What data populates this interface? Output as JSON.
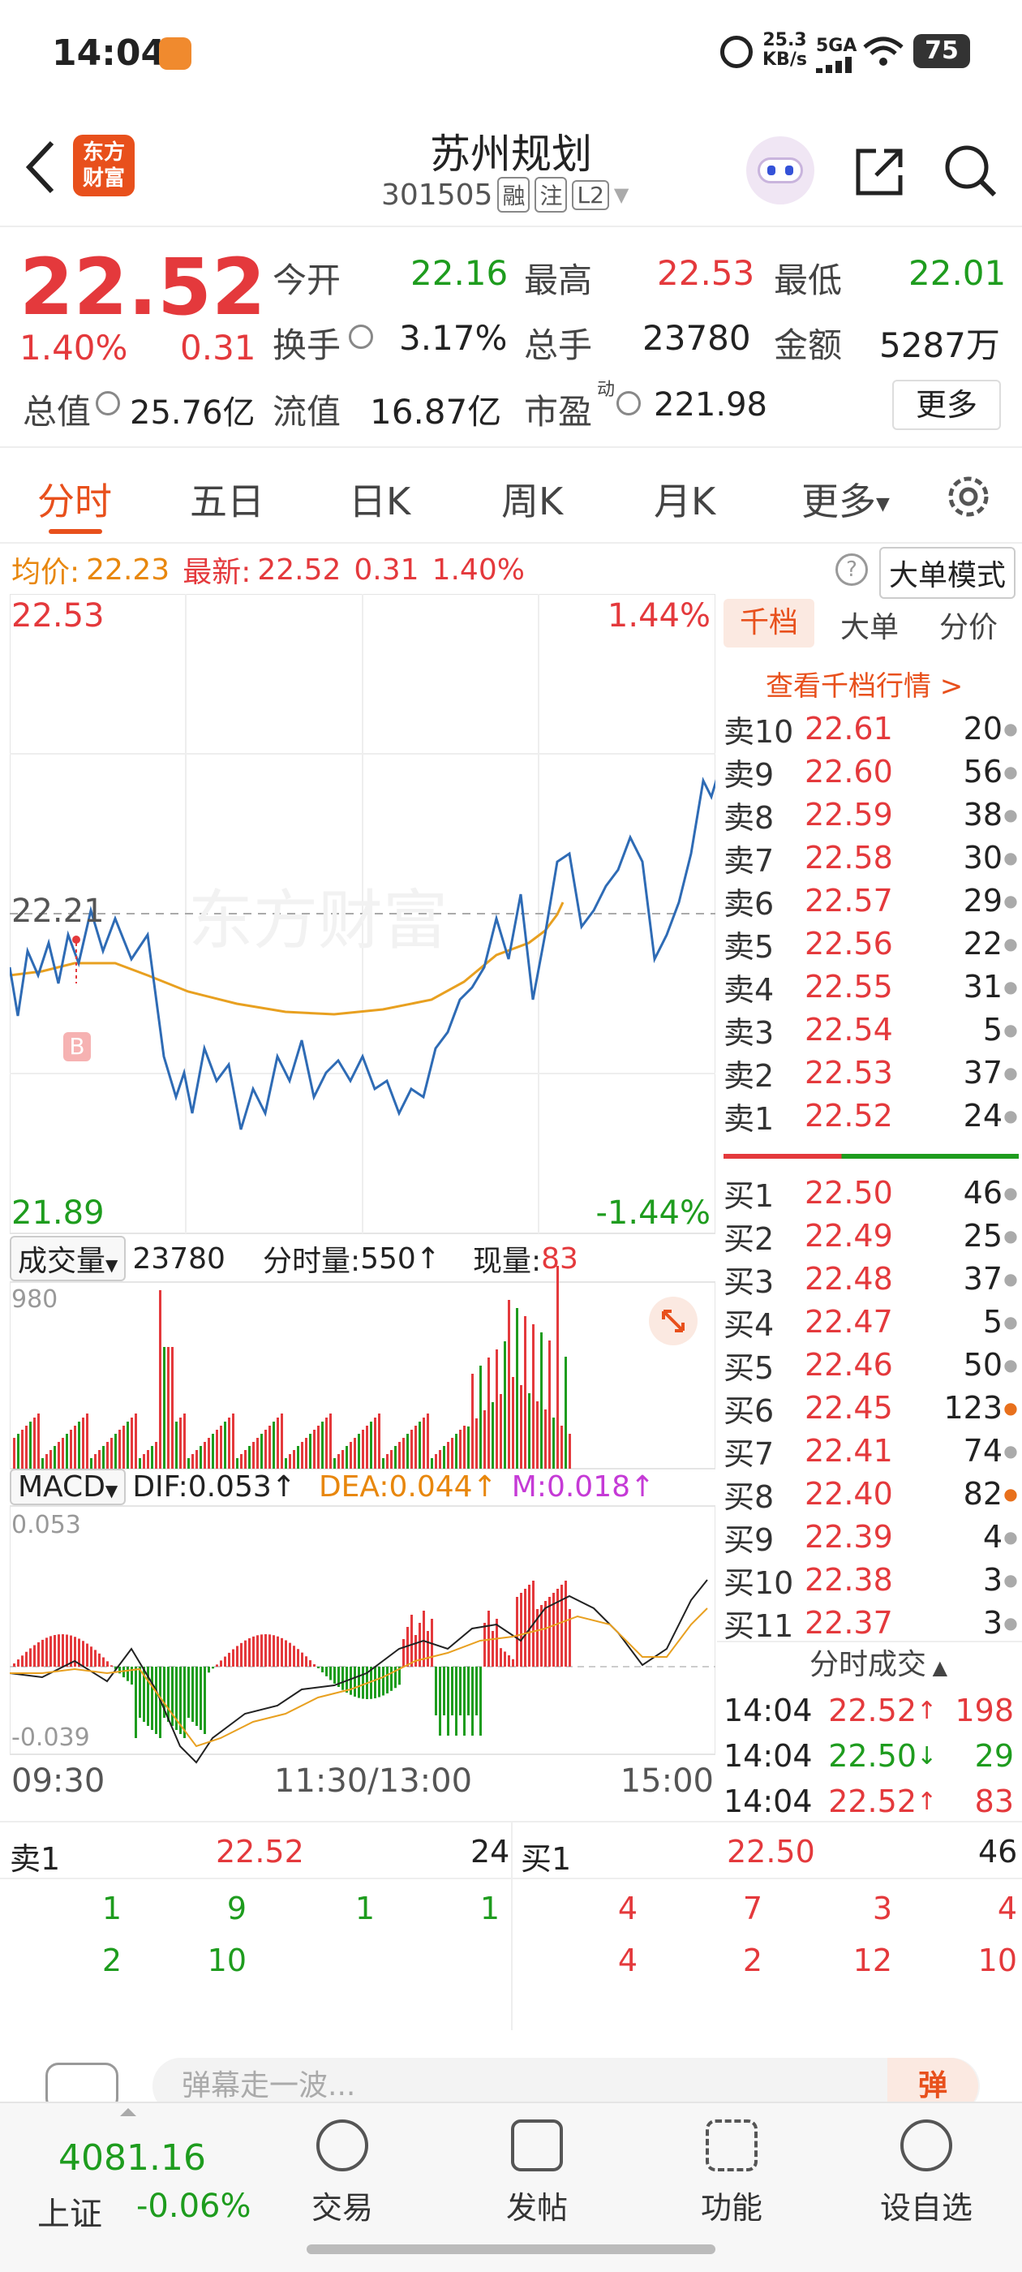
{
  "status_bar": {
    "time": "14:04",
    "net_speed": "25.3",
    "net_unit": "KB/s",
    "network": "5GA",
    "battery": "75"
  },
  "header": {
    "logo_line1": "东方",
    "logo_line2": "财富",
    "title": "苏州规划",
    "code": "301505",
    "tag_rong": "融",
    "tag_zhu": "注",
    "tag_l2": "L2"
  },
  "quote": {
    "price": "22.52",
    "change_pct": "1.40%",
    "change": "0.31",
    "open_label": "今开",
    "open": "22.16",
    "high_label": "最高",
    "high": "22.53",
    "low_label": "最低",
    "low": "22.01",
    "turnover_label": "换手",
    "turnover": "3.17%",
    "volume_label": "总手",
    "volume": "23780",
    "amount_label": "金额",
    "amount": "5287万",
    "mktcap_label": "总值",
    "mktcap": "25.76亿",
    "float_label": "流值",
    "float": "16.87亿",
    "pe_label": "市盈",
    "pe_sup": "动",
    "pe": "221.98",
    "more_button": "更多"
  },
  "tabs": [
    "分时",
    "五日",
    "日K",
    "周K",
    "月K",
    "更多"
  ],
  "avg_line": {
    "avg_label": "均价:",
    "avg": "22.23",
    "latest_label": "最新:",
    "latest": "22.52",
    "change": "0.31",
    "pct": "1.40%",
    "mode_button": "大单模式"
  },
  "chart": {
    "price_top": "22.53",
    "price_mid": "22.21",
    "price_bottom": "21.89",
    "pct_top": "1.44%",
    "pct_bottom": "-1.44%",
    "buy_marker": "B",
    "watermark": "东方财富",
    "vol_selector": "成交量",
    "vol_total": "23780",
    "vol_minute_label": "分时量:",
    "vol_minute": "550",
    "vol_now_label": "现量:",
    "vol_now": "83",
    "vol_max": "980",
    "macd_selector": "MACD",
    "dif": "DIF:0.053",
    "dea": "DEA:0.044",
    "m": "M:0.018",
    "macd_top": "0.053",
    "macd_bottom": "-0.039",
    "time_start": "09:30",
    "time_mid": "11:30/13:00",
    "time_end": "15:00"
  },
  "order_book": {
    "tabs": [
      "千档",
      "大单",
      "分价"
    ],
    "link": "查看千档行情 >",
    "asks": [
      {
        "label": "卖10",
        "price": "22.61",
        "vol": "20"
      },
      {
        "label": "卖9",
        "price": "22.60",
        "vol": "56"
      },
      {
        "label": "卖8",
        "price": "22.59",
        "vol": "38"
      },
      {
        "label": "卖7",
        "price": "22.58",
        "vol": "30"
      },
      {
        "label": "卖6",
        "price": "22.57",
        "vol": "29"
      },
      {
        "label": "卖5",
        "price": "22.56",
        "vol": "22"
      },
      {
        "label": "卖4",
        "price": "22.55",
        "vol": "31"
      },
      {
        "label": "卖3",
        "price": "22.54",
        "vol": "5"
      },
      {
        "label": "卖2",
        "price": "22.53",
        "vol": "37"
      },
      {
        "label": "卖1",
        "price": "22.52",
        "vol": "24"
      }
    ],
    "bids": [
      {
        "label": "买1",
        "price": "22.50",
        "vol": "46"
      },
      {
        "label": "买2",
        "price": "22.49",
        "vol": "25"
      },
      {
        "label": "买3",
        "price": "22.48",
        "vol": "37"
      },
      {
        "label": "买4",
        "price": "22.47",
        "vol": "5"
      },
      {
        "label": "买5",
        "price": "22.46",
        "vol": "50"
      },
      {
        "label": "买6",
        "price": "22.45",
        "vol": "123"
      },
      {
        "label": "买7",
        "price": "22.41",
        "vol": "74"
      },
      {
        "label": "买8",
        "price": "22.40",
        "vol": "82"
      },
      {
        "label": "买9",
        "price": "22.39",
        "vol": "4"
      },
      {
        "label": "买10",
        "price": "22.38",
        "vol": "3"
      },
      {
        "label": "买11",
        "price": "22.37",
        "vol": "3"
      }
    ],
    "trades_title": "分时成交",
    "trades": [
      {
        "time": "14:04",
        "price": "22.52",
        "dir": "up",
        "vol": "198"
      },
      {
        "time": "14:04",
        "price": "22.50",
        "dir": "down",
        "vol": "29"
      },
      {
        "time": "14:04",
        "price": "22.52",
        "dir": "up",
        "vol": "83"
      }
    ]
  },
  "summary": {
    "sell_label": "卖1",
    "sell_price": "22.52",
    "sell_vol": "24",
    "buy_label": "买1",
    "buy_price": "22.50",
    "buy_vol": "46",
    "sell_queue": [
      "1",
      "9",
      "1",
      "1",
      "2",
      "10"
    ],
    "buy_queue": [
      "4",
      "7",
      "3",
      "4",
      "4",
      "2",
      "12",
      "10"
    ]
  },
  "comment_bar": {
    "placeholder": "弹幕走一波...",
    "danmu_button": "弹"
  },
  "bottom_nav": {
    "index_value": "4081.16",
    "index_name": "上证",
    "index_change": "-0.06%",
    "items": [
      "交易",
      "发帖",
      "功能",
      "设自选"
    ]
  },
  "colors": {
    "up": "#e4393c",
    "down": "#1e9c1e",
    "brand": "#e8501c",
    "price_line": "#2e6bb5",
    "avg_line": "#e8a020"
  }
}
